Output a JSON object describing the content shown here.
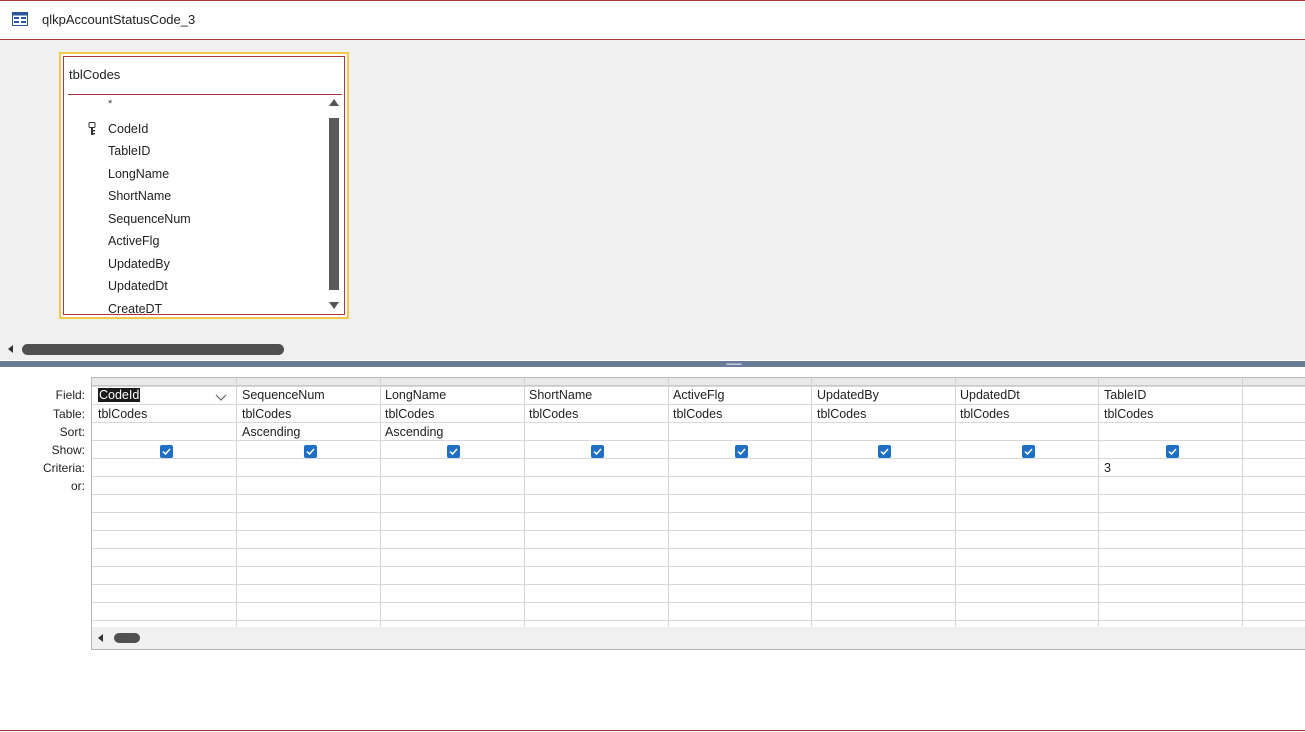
{
  "window": {
    "title": "qlkpAccountStatusCode_3"
  },
  "field_list": {
    "table_name": "tblCodes",
    "star": "*",
    "fields": [
      "CodeId",
      "TableID",
      "LongName",
      "ShortName",
      "SequenceNum",
      "ActiveFlg",
      "UpdatedBy",
      "UpdatedDt",
      "CreateDT"
    ],
    "primary_key": "CodeId"
  },
  "grid": {
    "row_labels": {
      "field": "Field:",
      "table": "Table:",
      "sort": "Sort:",
      "show": "Show:",
      "criteria": "Criteria:",
      "or": "or:"
    },
    "columns": [
      {
        "field": "CodeId",
        "table": "tblCodes",
        "sort": "",
        "show": true,
        "criteria": ""
      },
      {
        "field": "SequenceNum",
        "table": "tblCodes",
        "sort": "Ascending",
        "show": true,
        "criteria": ""
      },
      {
        "field": "LongName",
        "table": "tblCodes",
        "sort": "Ascending",
        "show": true,
        "criteria": ""
      },
      {
        "field": "ShortName",
        "table": "tblCodes",
        "sort": "",
        "show": true,
        "criteria": ""
      },
      {
        "field": "ActiveFlg",
        "table": "tblCodes",
        "sort": "",
        "show": true,
        "criteria": ""
      },
      {
        "field": "UpdatedBy",
        "table": "tblCodes",
        "sort": "",
        "show": true,
        "criteria": ""
      },
      {
        "field": "UpdatedDt",
        "table": "tblCodes",
        "sort": "",
        "show": true,
        "criteria": ""
      },
      {
        "field": "TableID",
        "table": "tblCodes",
        "sort": "",
        "show": true,
        "criteria": "3"
      }
    ]
  },
  "colors": {
    "accent_border": "#a4373a",
    "checkbox": "#1f6fc5",
    "field_list_highlight": "#f2c94c"
  }
}
